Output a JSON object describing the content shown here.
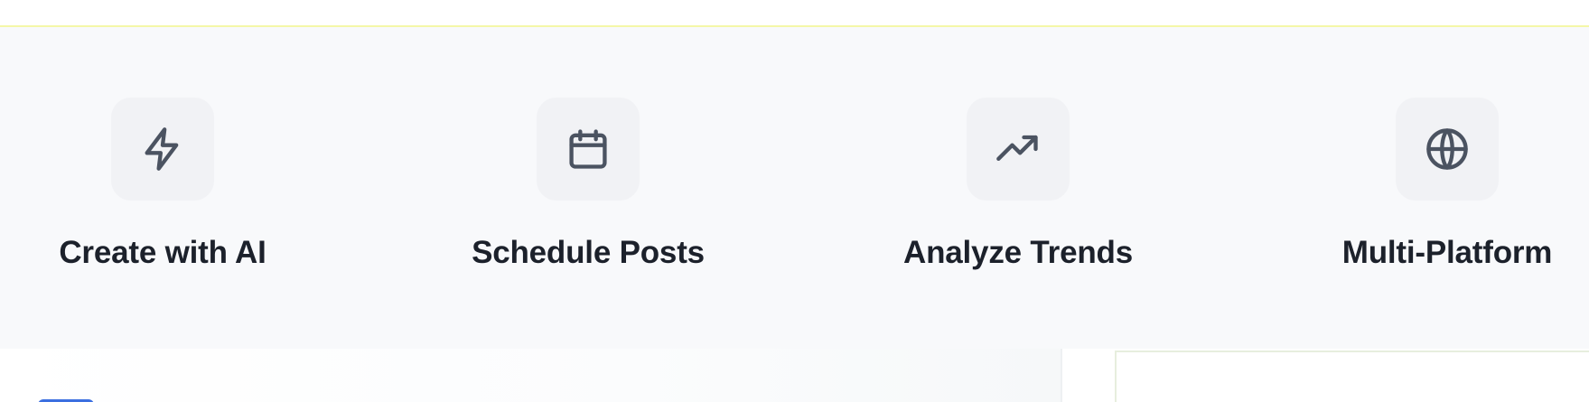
{
  "features": [
    {
      "label": "Create with AI",
      "icon": "lightning-icon"
    },
    {
      "label": "Schedule Posts",
      "icon": "calendar-icon"
    },
    {
      "label": "Analyze Trends",
      "icon": "trending-up-icon"
    },
    {
      "label": "Multi-Platform",
      "icon": "globe-icon"
    }
  ],
  "colors": {
    "section_background": "#f8f9fb",
    "icon_tile": "#f1f2f5",
    "icon_stroke": "#4b5361",
    "label_text": "#1c212b",
    "top_border": "#f4f7a8",
    "accent_chip": "#3b6fe0"
  }
}
